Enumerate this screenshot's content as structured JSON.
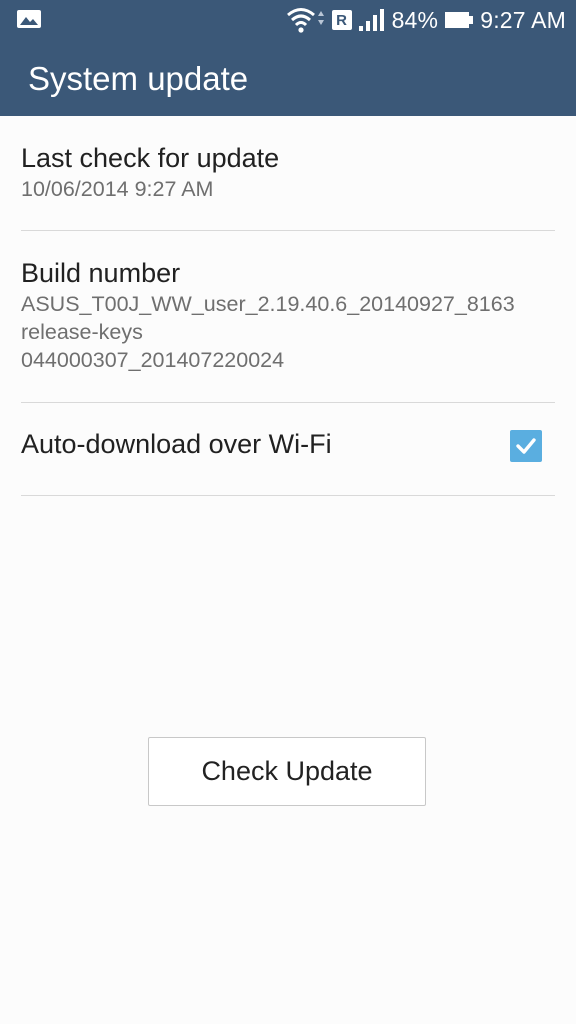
{
  "status_bar": {
    "left_icon": "image-icon",
    "wifi_icon": "wifi-icon",
    "roaming_label": "R",
    "signal_icon": "signal-icon",
    "battery_percent": "84%",
    "battery_icon": "battery-icon",
    "time": "9:27 AM"
  },
  "app_bar": {
    "title": "System update"
  },
  "preferences": {
    "last_check": {
      "title": "Last check for update",
      "summary": "10/06/2014 9:27 AM"
    },
    "build_number": {
      "title": "Build number",
      "summary": "ASUS_T00J_WW_user_2.19.40.6_20140927_8163\nrelease-keys\n044000307_201407220024"
    },
    "auto_download": {
      "title": "Auto-download over Wi-Fi",
      "checked": true
    }
  },
  "actions": {
    "check_update_label": "Check Update"
  },
  "colors": {
    "header": "#3b5878",
    "checkbox": "#5aaee0"
  }
}
